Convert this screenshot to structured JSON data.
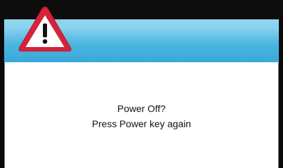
{
  "dialog": {
    "icon": "warning-icon",
    "line1": "Power Off?",
    "line2": "Press Power key again"
  },
  "colors": {
    "header_top": "#8ad3ef",
    "header_bottom": "#3aa9d8",
    "warning_red": "#d6223a",
    "frame": "#0a0a0a"
  }
}
